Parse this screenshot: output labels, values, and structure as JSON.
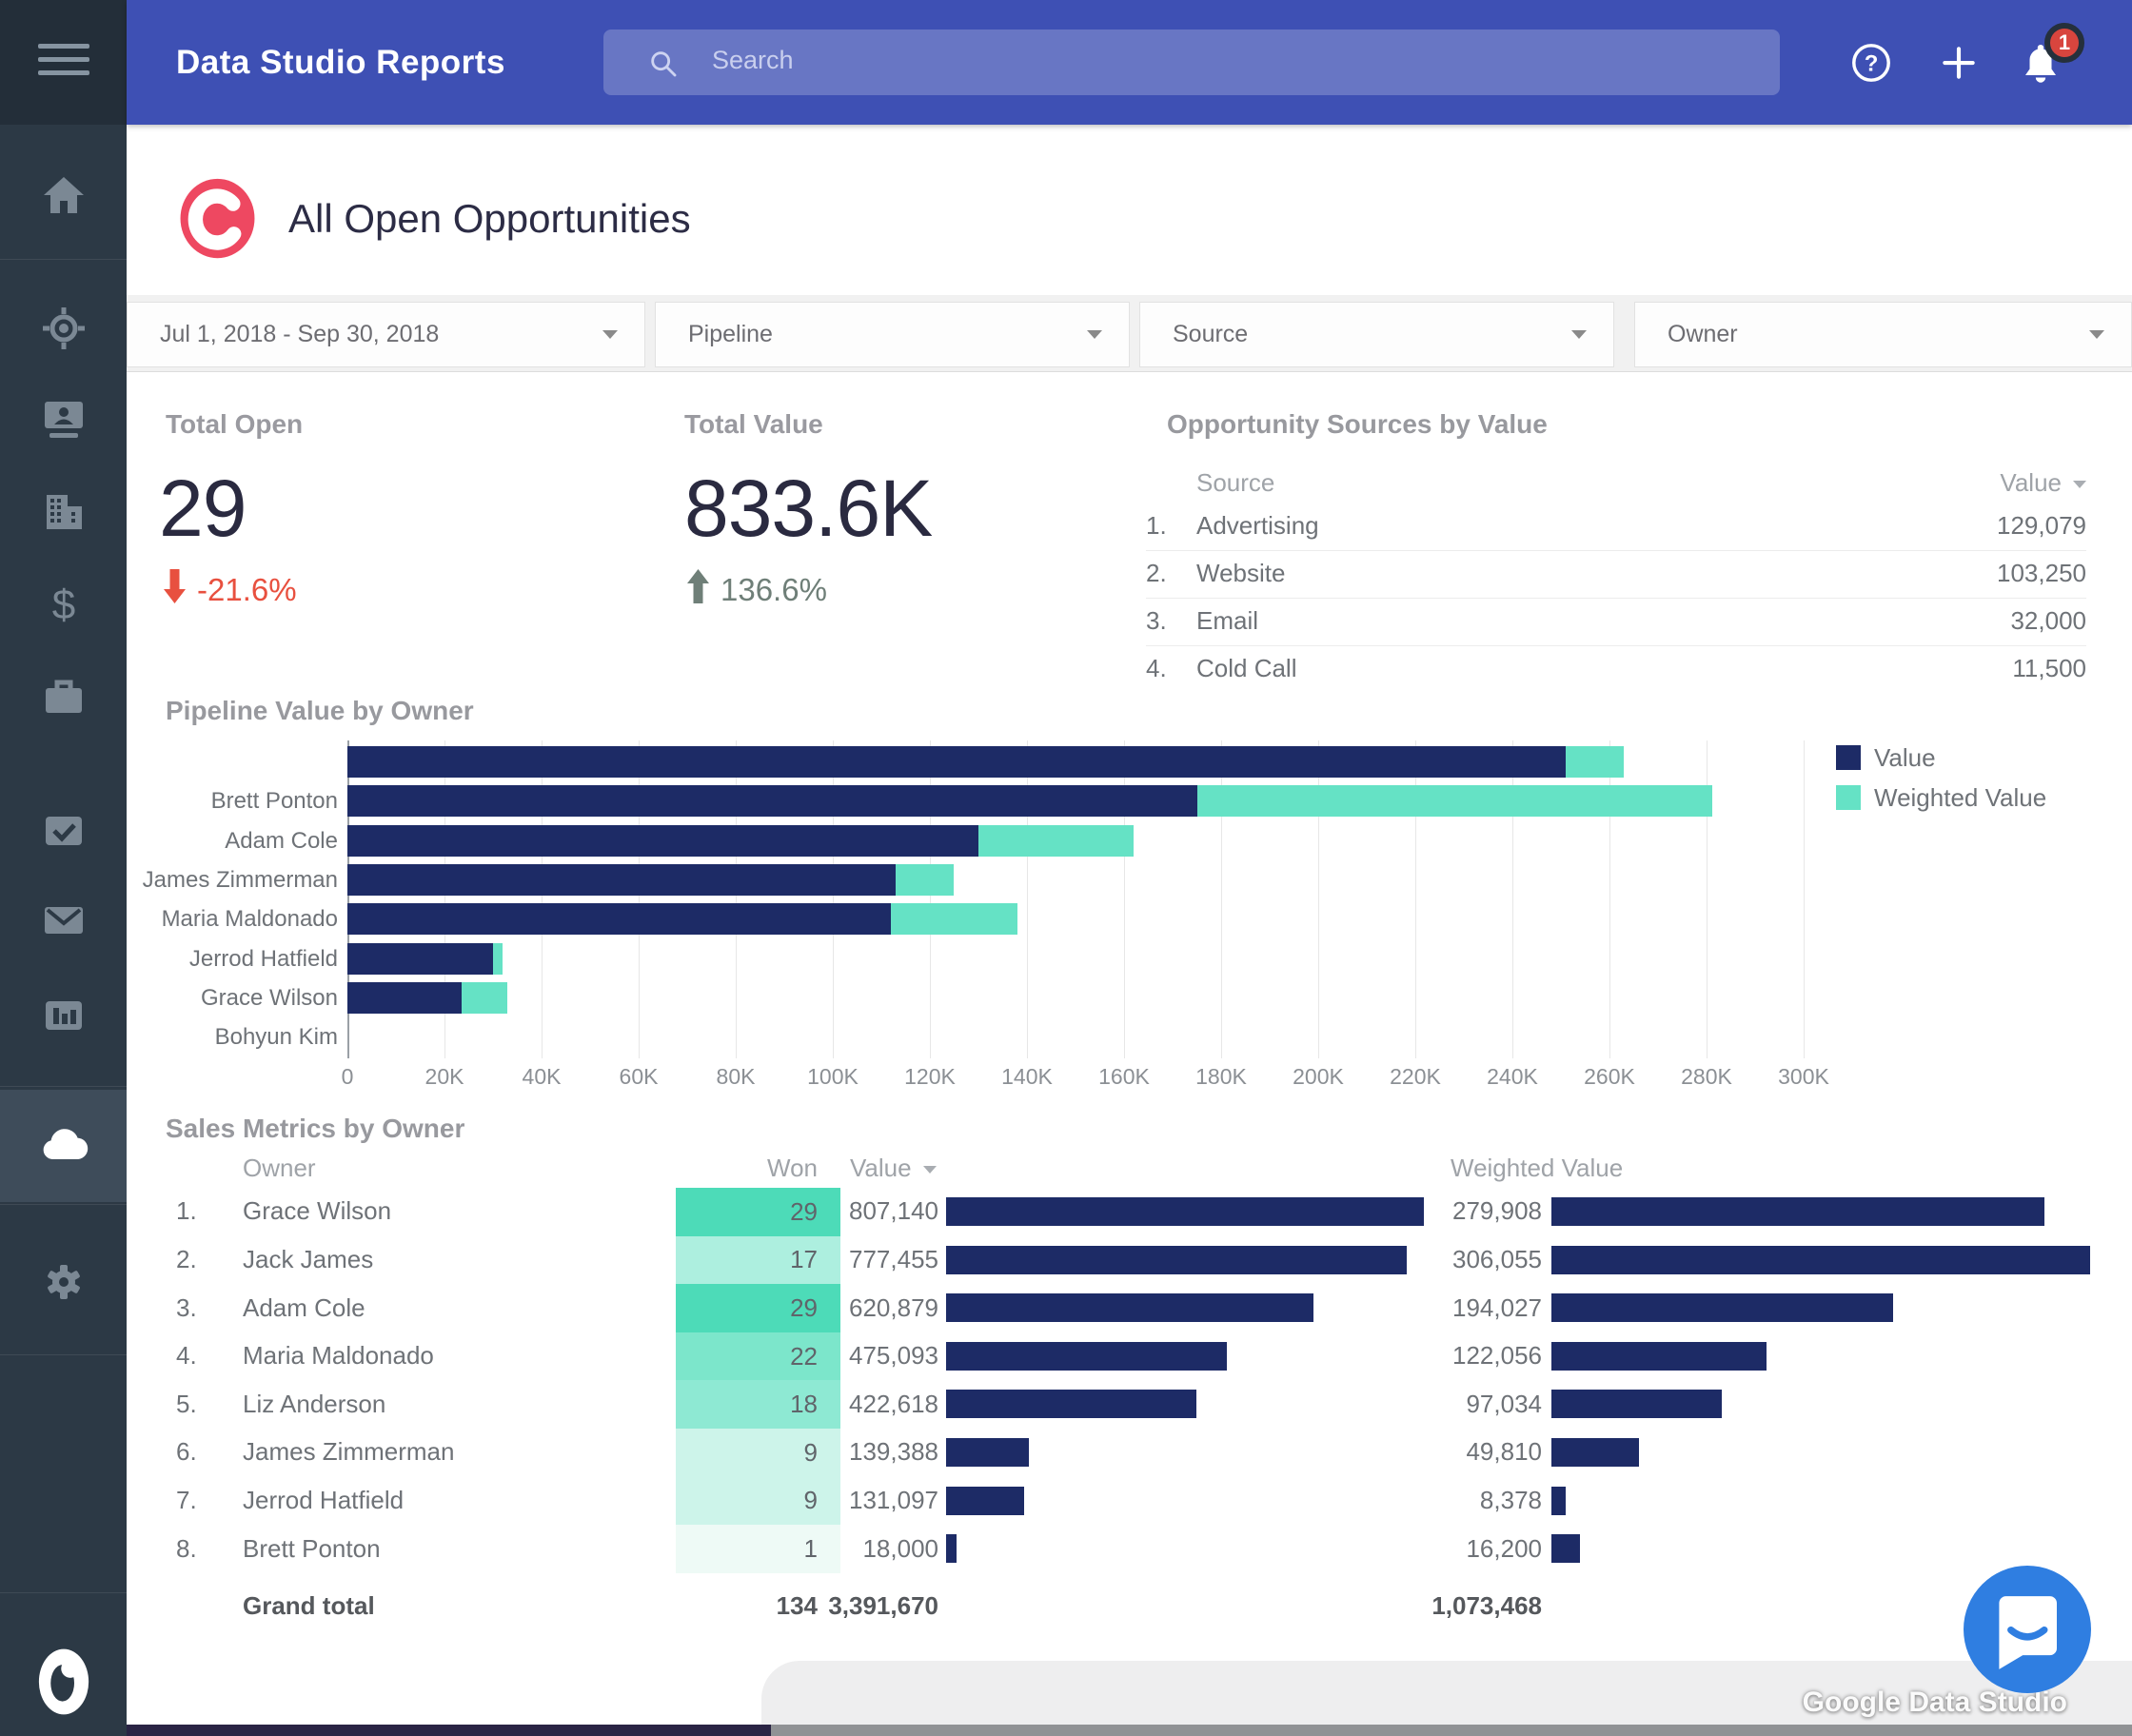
{
  "app": {
    "title": "Data Studio Reports",
    "search_placeholder": "Search",
    "notification_count": "1"
  },
  "sidebar": {
    "icons": [
      "hamburger-icon",
      "home-icon",
      "target-icon",
      "contacts-icon",
      "company-icon",
      "sales-icon",
      "briefcase-icon",
      "tasks-icon",
      "mail-icon",
      "reports-icon",
      "cloud-icon",
      "settings-icon",
      "copper-logo-icon"
    ],
    "active_icon": "cloud-icon"
  },
  "report": {
    "title": "All Open Opportunities",
    "filters": [
      "Jul 1, 2018 - Sep 30, 2018",
      "Pipeline",
      "Source",
      "Owner"
    ],
    "scorecards": [
      {
        "label": "Total Open",
        "value": "29",
        "delta": "-21.6%",
        "trend": "down",
        "color": "#e8503f"
      },
      {
        "label": "Total Value",
        "value": "833.6K",
        "delta": "136.6%",
        "trend": "up",
        "color": "#6f7f78"
      }
    ],
    "sources": {
      "title": "Opportunity Sources by Value",
      "col_source": "Source",
      "col_value": "Value",
      "rows": [
        {
          "rank": "1.",
          "source": "Advertising",
          "value": "129,079"
        },
        {
          "rank": "2.",
          "source": "Website",
          "value": "103,250"
        },
        {
          "rank": "3.",
          "source": "Email",
          "value": "32,000"
        },
        {
          "rank": "4.",
          "source": "Cold Call",
          "value": "11,500"
        }
      ]
    },
    "watermark": "Google Data Studio"
  },
  "chart_data": [
    {
      "type": "bar",
      "orientation": "horizontal",
      "stacked": true,
      "title": "Pipeline Value by Owner",
      "categories": [
        "",
        "Brett Ponton",
        "Adam Cole",
        "James Zimmerman",
        "Maria Maldonado",
        "Jerrod Hatfield",
        "Grace Wilson",
        "Bohyun Kim"
      ],
      "series": [
        {
          "name": "Value",
          "color": "#1d2b66",
          "values": [
            251000,
            175000,
            130000,
            113000,
            112000,
            30000,
            23500,
            0
          ]
        },
        {
          "name": "Weighted Value",
          "color": "#65e2c5",
          "values": [
            12000,
            106000,
            32000,
            12000,
            26000,
            2000,
            9500,
            0
          ]
        }
      ],
      "xlim": [
        0,
        305000
      ],
      "x_ticks": [
        "0",
        "20K",
        "40K",
        "60K",
        "80K",
        "100K",
        "120K",
        "140K",
        "160K",
        "180K",
        "200K",
        "220K",
        "240K",
        "260K",
        "280K",
        "300K"
      ],
      "grid": true,
      "legend_position": "right"
    },
    {
      "type": "table",
      "title": "Sales Metrics by Owner",
      "columns": {
        "owner": "Owner",
        "won": "Won",
        "value": "Value",
        "weighted": "Weighted Value"
      },
      "bar_color": "#1d2b66",
      "value_bar_max": 807140,
      "weighted_bar_max": 306055,
      "rows": [
        {
          "rank": "1.",
          "owner": "Grace Wilson",
          "won": "29",
          "won_color": "#4ddbb8",
          "value": 807140,
          "value_label": "807,140",
          "weighted": 279908,
          "weighted_label": "279,908"
        },
        {
          "rank": "2.",
          "owner": "Jack James",
          "won": "17",
          "won_color": "#adefdf",
          "value": 777455,
          "value_label": "777,455",
          "weighted": 306055,
          "weighted_label": "306,055"
        },
        {
          "rank": "3.",
          "owner": "Adam Cole",
          "won": "29",
          "won_color": "#4ddbb8",
          "value": 620879,
          "value_label": "620,879",
          "weighted": 194027,
          "weighted_label": "194,027"
        },
        {
          "rank": "4.",
          "owner": "Maria Maldonado",
          "won": "22",
          "won_color": "#7ce6cb",
          "value": 475093,
          "value_label": "475,093",
          "weighted": 122056,
          "weighted_label": "122,056"
        },
        {
          "rank": "5.",
          "owner": "Liz Anderson",
          "won": "18",
          "won_color": "#8ee9d3",
          "value": 422618,
          "value_label": "422,618",
          "weighted": 97034,
          "weighted_label": "97,034"
        },
        {
          "rank": "6.",
          "owner": "James Zimmerman",
          "won": "9",
          "won_color": "#cdf4ea",
          "value": 139388,
          "value_label": "139,388",
          "weighted": 49810,
          "weighted_label": "49,810"
        },
        {
          "rank": "7.",
          "owner": "Jerrod Hatfield",
          "won": "9",
          "won_color": "#cdf4ea",
          "value": 131097,
          "value_label": "131,097",
          "weighted": 8378,
          "weighted_label": "8,378"
        },
        {
          "rank": "8.",
          "owner": "Brett Ponton",
          "won": "1",
          "won_color": "#eefaf6",
          "value": 18000,
          "value_label": "18,000",
          "weighted": 16200,
          "weighted_label": "16,200"
        }
      ],
      "grand_total": {
        "label": "Grand total",
        "won": "134",
        "value": "3,391,670",
        "weighted": "1,073,468"
      }
    }
  ]
}
